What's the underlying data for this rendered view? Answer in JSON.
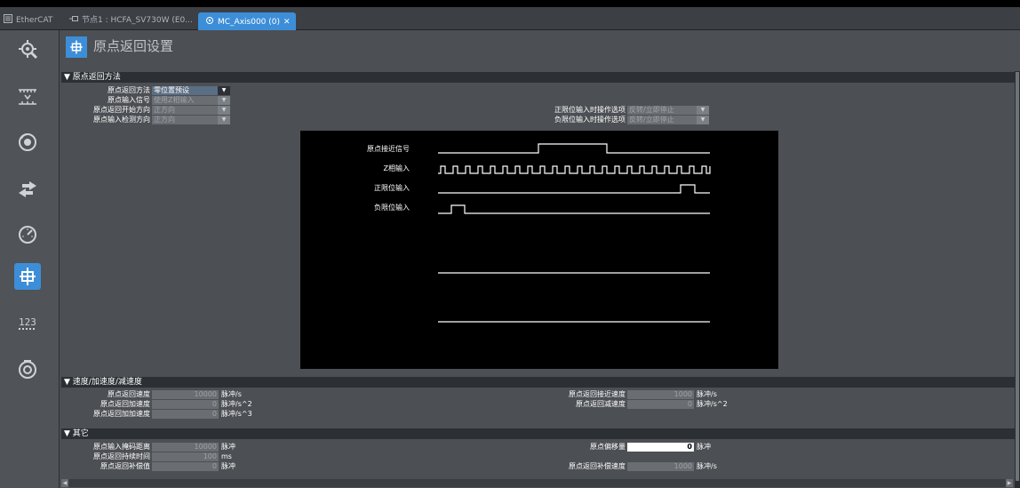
{
  "tabs": [
    {
      "label": "EtherCAT",
      "icon": "network-icon"
    },
    {
      "label": "节点1 : HCFA_SV730W (E0...",
      "icon": "node-icon"
    },
    {
      "label": "MC_Axis000 (0)",
      "icon": "axis-icon",
      "active": true,
      "close": "✕"
    }
  ],
  "sidebar": {
    "items": [
      {
        "name": "axis-settings-icon"
      },
      {
        "name": "unit-conversion-icon"
      },
      {
        "name": "operation-settings-icon"
      },
      {
        "name": "other-operation-icon"
      },
      {
        "name": "limit-settings-icon"
      },
      {
        "name": "homing-settings-icon",
        "selected": true
      },
      {
        "name": "position-count-icon"
      },
      {
        "name": "servo-drive-icon"
      }
    ]
  },
  "page": {
    "title": "原点返回设置"
  },
  "homing_method": {
    "header": "▼ 原点返回方法",
    "method_label": "原点返回方法",
    "method_value": "零位置预设",
    "input_signal_label": "原点输入信号",
    "input_signal_value": "使用Z相输入",
    "start_dir_label": "原点返回开始方向",
    "start_dir_value": "正方向",
    "detect_dir_label": "原点输入检测方向",
    "detect_dir_value": "正方向",
    "pos_limit_label": "正限位输入时操作选项",
    "pos_limit_value": "反转/立即停止",
    "neg_limit_label": "负限位输入时操作选项",
    "neg_limit_value": "反转/立即停止",
    "arrow": "▼"
  },
  "diagram": {
    "signals": [
      "原点接近信号",
      "Z相输入",
      "正限位输入",
      "负限位输入"
    ]
  },
  "speed": {
    "header": "▼ 速度/加速度/减速度",
    "homing_speed_label": "原点返回速度",
    "homing_speed_value": "10000",
    "homing_speed_unit": "脉冲/s",
    "homing_acc_label": "原点返回加速度",
    "homing_acc_value": "0",
    "homing_acc_unit": "脉冲/s^2",
    "homing_jerk_label": "原点返回加加速度",
    "homing_jerk_value": "0",
    "homing_jerk_unit": "脉冲/s^3",
    "approach_speed_label": "原点返回接近速度",
    "approach_speed_value": "1000",
    "approach_speed_unit": "脉冲/s",
    "homing_dec_label": "原点返回减速度",
    "homing_dec_value": "0",
    "homing_dec_unit": "脉冲/s^2"
  },
  "other": {
    "header": "▼ 其它",
    "mask_label": "原点输入掩码距离",
    "mask_value": "10000",
    "mask_unit": "脉冲",
    "hold_label": "原点返回持续时间",
    "hold_value": "100",
    "hold_unit": "ms",
    "comp_label": "原点返回补偿值",
    "comp_value": "0",
    "comp_unit": "脉冲",
    "offset_label": "原点偏移量",
    "offset_value": "0",
    "offset_unit": "脉冲",
    "comp_speed_label": "原点返回补偿速度",
    "comp_speed_value": "1000",
    "comp_speed_unit": "脉冲/s"
  },
  "scroll": {
    "left": "◀",
    "right": "▶"
  },
  "colors": {
    "accent": "#3d8ed8",
    "panel": "#4c4f53",
    "section": "#2c3035"
  }
}
